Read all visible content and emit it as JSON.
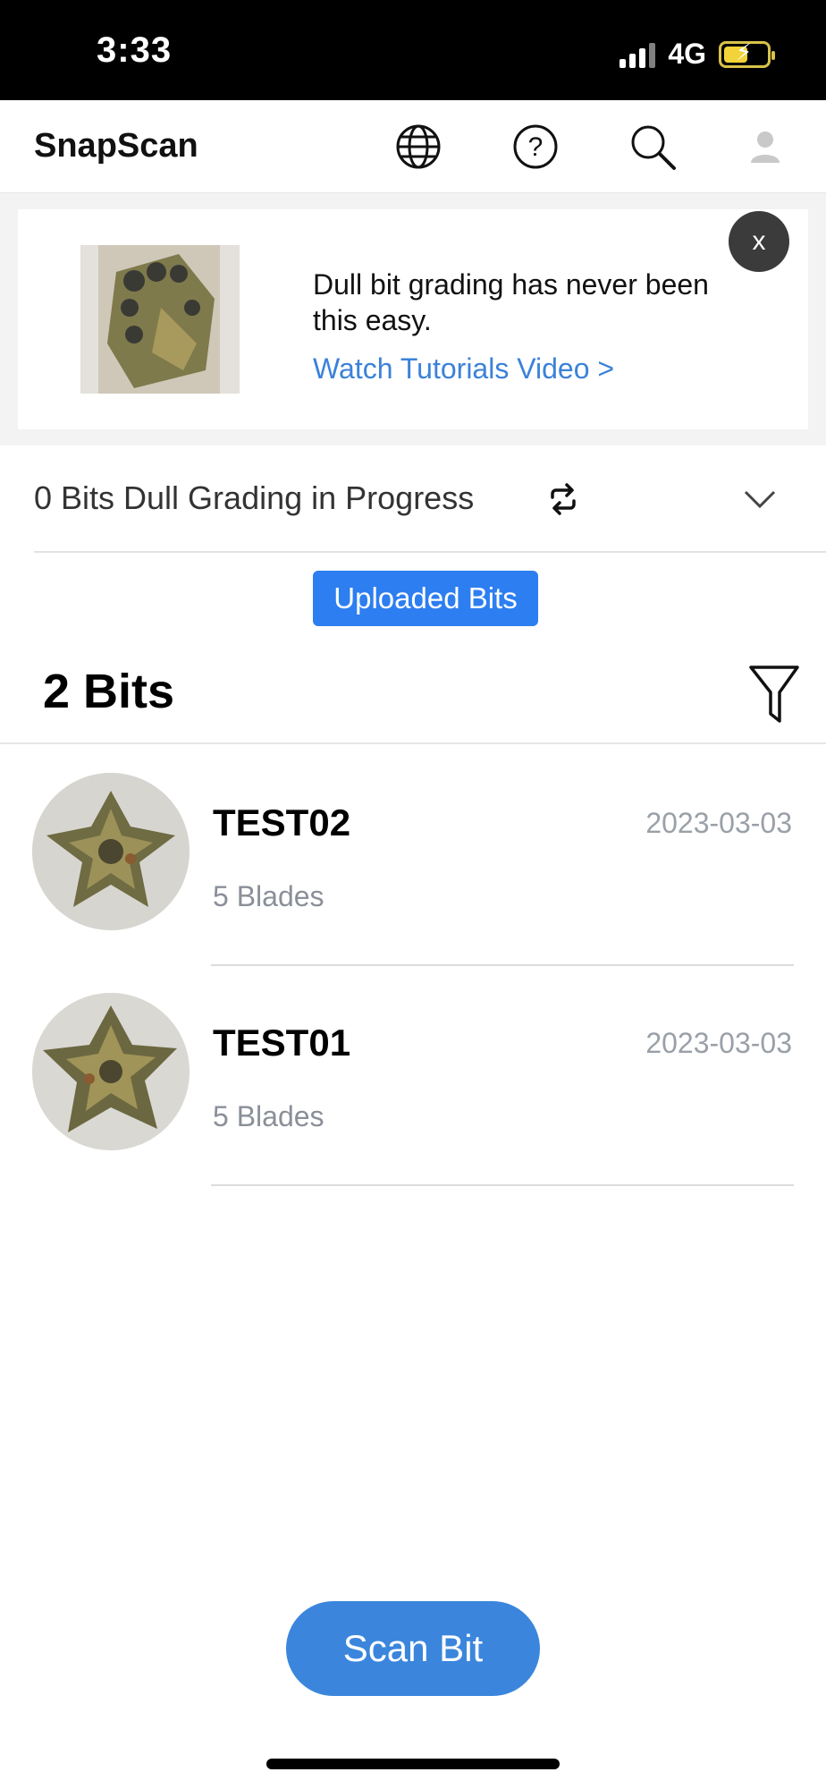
{
  "status_bar": {
    "time": "3:33",
    "network": "4G"
  },
  "header": {
    "title": "SnapScan",
    "icons": [
      "globe-icon",
      "help-icon",
      "search-icon",
      "profile-icon"
    ]
  },
  "banner": {
    "text": "Dull bit grading has never been this easy.",
    "link": "Watch Tutorials Video >",
    "close_label": "x"
  },
  "progress": {
    "text": "0 Bits Dull Grading in  Progress"
  },
  "uploaded_button": "Uploaded Bits",
  "bits_count": "2 Bits",
  "bits": [
    {
      "name": "TEST02",
      "blades": "5 Blades",
      "date": "2023-03-03"
    },
    {
      "name": "TEST01",
      "blades": "5 Blades",
      "date": "2023-03-03"
    }
  ],
  "scan_button": "Scan Bit",
  "colors": {
    "accent": "#3b86dc",
    "uploaded_button": "#2d7ef0",
    "link": "#3b82d9"
  }
}
